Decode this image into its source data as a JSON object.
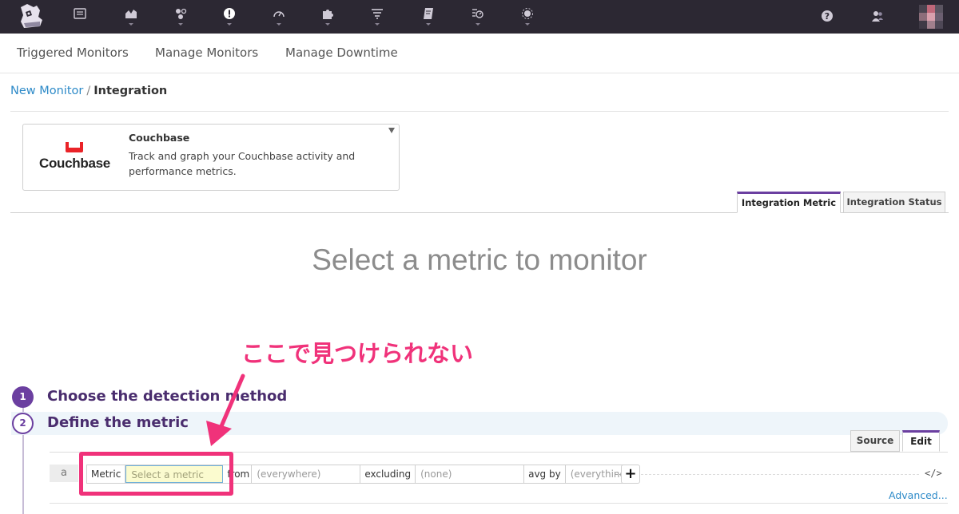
{
  "topbar": {
    "nav_icons": [
      "list-icon",
      "dashboard-chart-icon",
      "infrastructure-icon",
      "monitors-alert-icon",
      "apm-gauge-icon",
      "integrations-puzzle-icon",
      "logs-filter-icon",
      "notebook-icon",
      "synthetics-icon",
      "security-icon"
    ],
    "right_icons": [
      "help-icon",
      "team-icon"
    ]
  },
  "subnav": {
    "items": [
      "Triggered Monitors",
      "Manage Monitors",
      "Manage Downtime"
    ]
  },
  "breadcrumb": {
    "parent": "New Monitor",
    "separator": "/",
    "current": "Integration"
  },
  "integration": {
    "logo_text": "Couchbase",
    "name": "Couchbase",
    "description": "Track and graph your Couchbase activity and performance metrics.",
    "brand_color": "#ea2328"
  },
  "integration_tabs": [
    "Integration Metric",
    "Integration Status"
  ],
  "hero": "Select a metric to monitor",
  "annotation": "ここで見つけられない",
  "steps": [
    {
      "number": "1",
      "title": "Choose the detection method"
    },
    {
      "number": "2",
      "title": "Define the metric"
    }
  ],
  "editor_tabs": {
    "source": "Source",
    "edit": "Edit"
  },
  "query": {
    "letter": "a",
    "metric_label": "Metric",
    "metric_placeholder": "Select a metric",
    "from_label": "from",
    "from_value": "(everywhere)",
    "excluding_label": "excluding",
    "excluding_value": "(none)",
    "avg_label": "avg by",
    "avg_value": "(everything)",
    "add": "+",
    "code_toggle": "</>",
    "advanced": "Advanced..."
  },
  "colors": {
    "topbar": "#2c2833",
    "accent_purple": "#6b3fa0",
    "link_blue": "#2d8ac8",
    "annotation_pink": "#f0327a"
  }
}
